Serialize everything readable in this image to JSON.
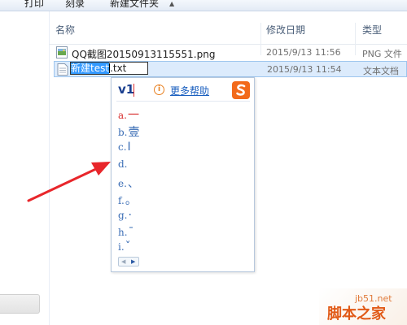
{
  "toolbar": {
    "print_label": "打印",
    "burn_label": "刻录",
    "new_folder_label": "新建文件夹"
  },
  "columns": {
    "name": "名称",
    "date_modified": "修改日期",
    "type": "类型"
  },
  "files": [
    {
      "name": "QQ截图20150913115551.png",
      "date": "2015/9/13 11:56",
      "type": "PNG 文件",
      "icon": "png-image-icon"
    },
    {
      "name": "新建test.txt",
      "date": "2015/9/13 11:54",
      "type": "文本文档",
      "icon": "text-file-icon"
    }
  ],
  "rename": {
    "selected_text": "新建test",
    "extension": ".txt"
  },
  "ime": {
    "code": "v1",
    "help": "更多帮助",
    "candidates": [
      {
        "label": "a.",
        "char": "一"
      },
      {
        "label": "b.",
        "char": "壹"
      },
      {
        "label": "c.",
        "char": "Ⅰ"
      },
      {
        "label": "d.",
        "char": ""
      },
      {
        "label": "e.",
        "char": "、"
      },
      {
        "label": "f.",
        "char": "。"
      },
      {
        "label": "g.",
        "char": "·"
      },
      {
        "label": "h.",
        "char": "ˉ"
      },
      {
        "label": "i.",
        "char": "ˇ"
      }
    ]
  },
  "watermark": {
    "url": "jb51.net",
    "name": "脚本之家"
  },
  "colors": {
    "selection": "#3399ff",
    "row_highlight": "#dcebfc",
    "arrow": "#e8262b",
    "candidate": "#3a6db5",
    "candidate_active": "#d83030",
    "sogou_orange": "#f26a1b"
  }
}
